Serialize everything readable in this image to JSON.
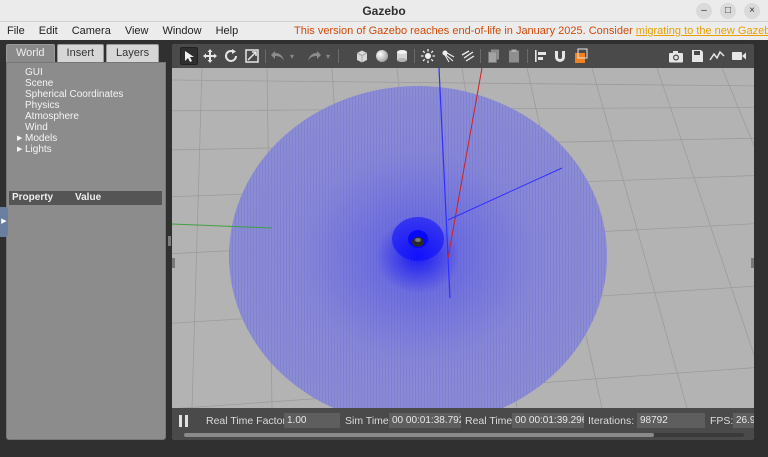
{
  "window": {
    "title": "Gazebo",
    "controls": [
      "–",
      "□",
      "×"
    ]
  },
  "menu": [
    "File",
    "Edit",
    "Camera",
    "View",
    "Window",
    "Help"
  ],
  "notice": {
    "text": "This version of Gazebo reaches end-of-life in January 2025. Consider ",
    "link": "migrating to the new Gazebo"
  },
  "tabs": [
    "World",
    "Insert",
    "Layers"
  ],
  "tree": [
    {
      "label": "GUI",
      "expandable": false
    },
    {
      "label": "Scene",
      "expandable": false
    },
    {
      "label": "Spherical Coordinates",
      "expandable": false
    },
    {
      "label": "Physics",
      "expandable": false
    },
    {
      "label": "Atmosphere",
      "expandable": false
    },
    {
      "label": "Wind",
      "expandable": false
    },
    {
      "label": "Models",
      "expandable": true
    },
    {
      "label": "Lights",
      "expandable": true
    }
  ],
  "properties": {
    "col1": "Property",
    "col2": "Value"
  },
  "toolbar": {
    "icons": [
      "select-arrow-icon",
      "translate-icon",
      "rotate-icon",
      "scale-icon",
      "undo-icon",
      "redo-icon",
      "box-shape-icon",
      "sphere-shape-icon",
      "cylinder-shape-icon",
      "point-light-icon",
      "spot-light-icon",
      "directional-light-icon",
      "copy-icon",
      "paste-icon",
      "align-icon",
      "snap-icon",
      "color-model-icon",
      "screenshot-icon",
      "save-log-icon",
      "plot-icon",
      "record-video-icon"
    ]
  },
  "stats": {
    "real_time_factor_label": "Real Time Factor:",
    "real_time_factor": "1.00",
    "sim_time_label": "Sim Time:",
    "sim_time": "00 00:01:38.792",
    "real_time_label": "Real Time:",
    "real_time": "00 00:01:39.296",
    "iterations_label": "Iterations:",
    "iterations": "98792",
    "fps_label": "FPS:",
    "fps": "26.9"
  },
  "colors": {
    "accent_orange": "#e8a000",
    "notice": "#d04a08",
    "lidar_blue": "#3a3cf0",
    "viewport_bg": "#b3b3b3"
  }
}
